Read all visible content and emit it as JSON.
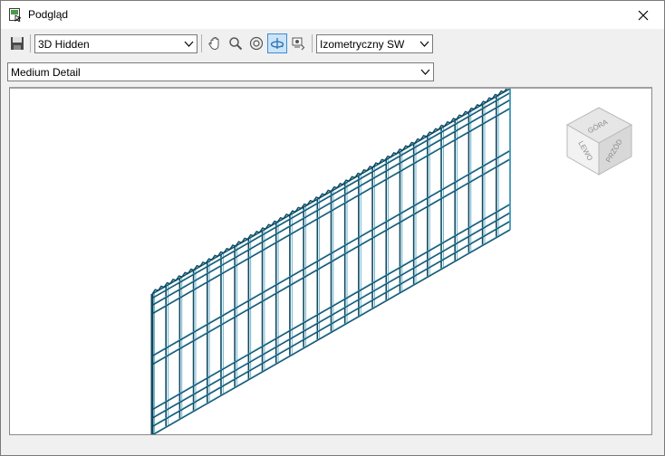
{
  "window": {
    "title": "Podgląd"
  },
  "toolbar": {
    "visual_style": "3D Hidden",
    "view_direction": "Izometryczny SW",
    "detail_level": "Medium Detail",
    "tools": [
      "save-icon",
      "pan-icon",
      "zoom-icon",
      "orbit-icon",
      "rotate-icon",
      "camera-icon"
    ]
  },
  "viewcube": {
    "top": "GÓRA",
    "left": "LEWO",
    "front": "PRZÓD"
  },
  "colors": {
    "mesh": "#0f4a60",
    "mesh_highlight": "#4aa3c8",
    "active_tool": "#cce4f7"
  }
}
